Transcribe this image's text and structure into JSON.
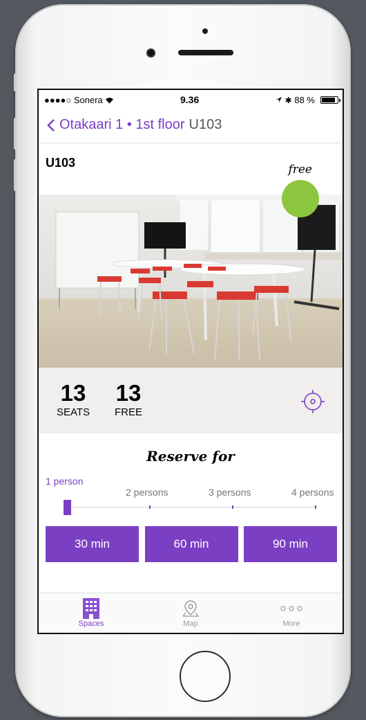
{
  "status_bar": {
    "carrier": "●●●●○ Sonera",
    "time": "9.36",
    "battery_text": "88 %",
    "battery_level": 0.88
  },
  "nav": {
    "back_label": "Otakaari 1 • 1st floor",
    "title": "U103"
  },
  "room": {
    "name": "U103",
    "availability": "free",
    "availability_color": "#8cc63f",
    "seats_count": "13",
    "seats_label": "SEATS",
    "free_count": "13",
    "free_label": "FREE"
  },
  "reserve": {
    "title": "Reserve for",
    "person_options": [
      "1 person",
      "2 persons",
      "3 persons",
      "4 persons"
    ],
    "selected_option": "1 person",
    "durations": [
      "30 min",
      "60 min",
      "90 min"
    ]
  },
  "tabbar": {
    "tabs": [
      {
        "label": "Spaces",
        "icon": "building-icon",
        "active": true
      },
      {
        "label": "Map",
        "icon": "map-pin-icon",
        "active": false
      },
      {
        "label": "More",
        "icon": "more-dots-icon",
        "active": false
      }
    ]
  },
  "colors": {
    "accent": "#7b3fc4",
    "status_free": "#8cc63f"
  }
}
